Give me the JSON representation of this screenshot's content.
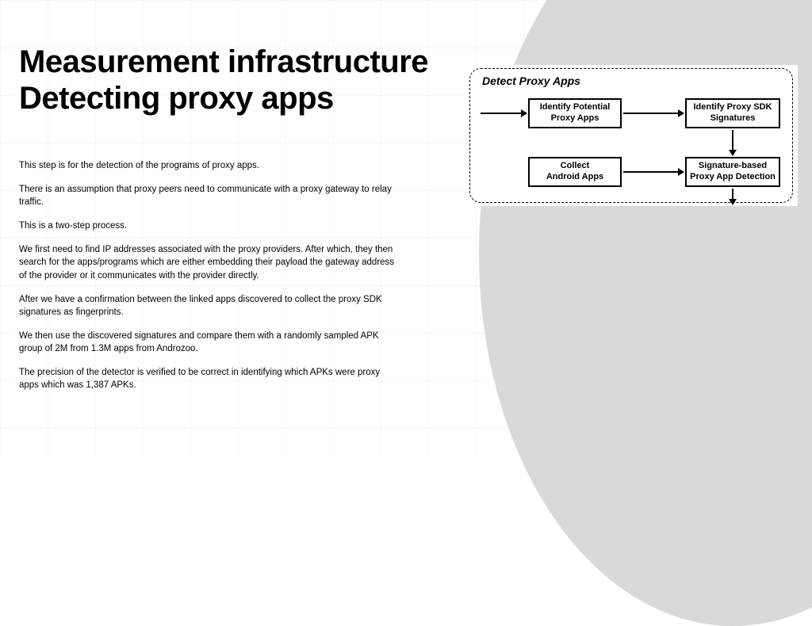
{
  "title": "Measurement infrastructure\nDetecting proxy apps",
  "paragraphs": [
    "This step is for the detection of the programs of proxy apps.",
    "There is an assumption that proxy peers need to communicate with a proxy gateway to relay traffic.",
    "This is a two-step process.",
    "We first need to find IP addresses associated with the proxy providers. After which, they then search for the apps/programs which are either embedding their payload the gateway address of the provider or it communicates with the provider directly.",
    "After we have a confirmation between the linked apps discovered to collect the proxy SDK signatures as fingerprints.",
    "We then use the discovered signatures and compare them with a randomly sampled APK group of 2M from 1.3M apps from Androzoo.",
    "The precision of the detector is verified to be correct in identifying which APKs were proxy apps which was 1,387 APKs."
  ],
  "diagram": {
    "title": "Detect Proxy Apps",
    "nodes": {
      "n1": "Identify Potential\nProxy Apps",
      "n2": "Identify Proxy SDK\nSignatures",
      "n3": "Collect\nAndroid Apps",
      "n4": "Signature-based\nProxy App Detection"
    }
  }
}
